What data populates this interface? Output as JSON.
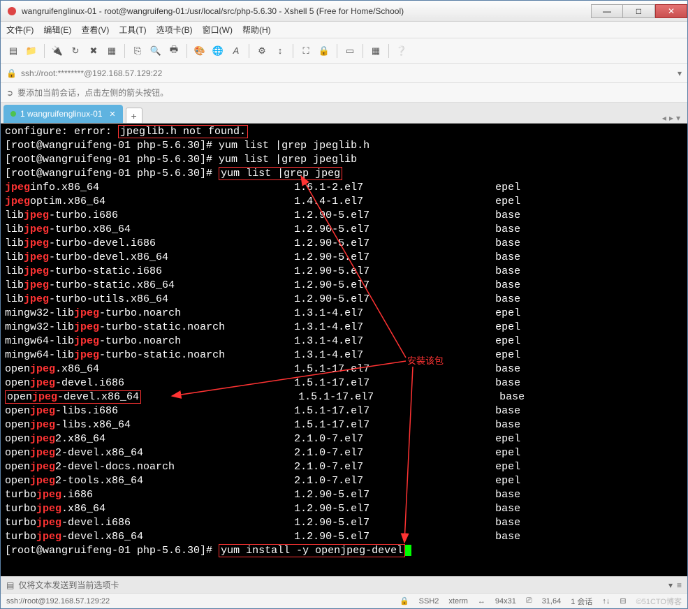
{
  "window": {
    "title": "wangruifenglinux-01 - root@wangruifeng-01:/usr/local/src/php-5.6.30 - Xshell 5 (Free for Home/School)"
  },
  "menu": {
    "file": "文件(F)",
    "edit": "编辑(E)",
    "view": "查看(V)",
    "tools": "工具(T)",
    "opt": "选项卡(B)",
    "window": "窗口(W)",
    "help": "帮助(H)"
  },
  "address": {
    "text": "ssh://root:********@192.168.57.129:22"
  },
  "infobar": {
    "text": "要添加当前会话，点击左侧的箭头按钮。"
  },
  "tab": {
    "label": "1 wangruifenglinux-01",
    "newtab": "+"
  },
  "annotation": {
    "text": "安装该包"
  },
  "terminal": {
    "line_err_p": "configure: error: ",
    "line_err_box": "jpeglib.h not found.",
    "prompt": "[root@wangruifeng-01 php-5.6.30]# ",
    "cmd1": "yum list |grep jpeglib.h",
    "cmd2": "yum list |grep jpeglib",
    "cmd3box": "yum list |grep jpeg",
    "cmd4box": "yum install -y openjpeg-devel",
    "rows": [
      {
        "p": "jpeg",
        "r": "info.x86_64",
        "v": "1.6.1-2.el7",
        "repo": "epel"
      },
      {
        "p": "jpeg",
        "r": "optim.x86_64",
        "v": "1.4.4-1.el7",
        "repo": "epel"
      },
      {
        "p": "lib",
        "m": "jpeg",
        "r": "-turbo.i686",
        "v": "1.2.90-5.el7",
        "repo": "base"
      },
      {
        "p": "lib",
        "m": "jpeg",
        "r": "-turbo.x86_64",
        "v": "1.2.90-5.el7",
        "repo": "base"
      },
      {
        "p": "lib",
        "m": "jpeg",
        "r": "-turbo-devel.i686",
        "v": "1.2.90-5.el7",
        "repo": "base"
      },
      {
        "p": "lib",
        "m": "jpeg",
        "r": "-turbo-devel.x86_64",
        "v": "1.2.90-5.el7",
        "repo": "base"
      },
      {
        "p": "lib",
        "m": "jpeg",
        "r": "-turbo-static.i686",
        "v": "1.2.90-5.el7",
        "repo": "base"
      },
      {
        "p": "lib",
        "m": "jpeg",
        "r": "-turbo-static.x86_64",
        "v": "1.2.90-5.el7",
        "repo": "base"
      },
      {
        "p": "lib",
        "m": "jpeg",
        "r": "-turbo-utils.x86_64",
        "v": "1.2.90-5.el7",
        "repo": "base"
      },
      {
        "p": "mingw32-lib",
        "m": "jpeg",
        "r": "-turbo.noarch",
        "v": "1.3.1-4.el7",
        "repo": "epel"
      },
      {
        "p": "mingw32-lib",
        "m": "jpeg",
        "r": "-turbo-static.noarch",
        "v": "1.3.1-4.el7",
        "repo": "epel"
      },
      {
        "p": "mingw64-lib",
        "m": "jpeg",
        "r": "-turbo.noarch",
        "v": "1.3.1-4.el7",
        "repo": "epel"
      },
      {
        "p": "mingw64-lib",
        "m": "jpeg",
        "r": "-turbo-static.noarch",
        "v": "1.3.1-4.el7",
        "repo": "epel"
      },
      {
        "p": "open",
        "m": "jpeg",
        "r": ".x86_64",
        "v": "1.5.1-17.el7",
        "repo": "base"
      },
      {
        "p": "open",
        "m": "jpeg",
        "r": "-devel.i686",
        "v": "1.5.1-17.el7",
        "repo": "base"
      },
      {
        "p": "open",
        "m": "jpeg",
        "r": "-devel.x86_64",
        "v": "1.5.1-17.el7",
        "repo": "base",
        "boxed": true
      },
      {
        "p": "open",
        "m": "jpeg",
        "r": "-libs.i686",
        "v": "1.5.1-17.el7",
        "repo": "base"
      },
      {
        "p": "open",
        "m": "jpeg",
        "r": "-libs.x86_64",
        "v": "1.5.1-17.el7",
        "repo": "base"
      },
      {
        "p": "open",
        "m": "jpeg",
        "r": "2.x86_64",
        "v": "2.1.0-7.el7",
        "repo": "epel"
      },
      {
        "p": "open",
        "m": "jpeg",
        "r": "2-devel.x86_64",
        "v": "2.1.0-7.el7",
        "repo": "epel"
      },
      {
        "p": "open",
        "m": "jpeg",
        "r": "2-devel-docs.noarch",
        "v": "2.1.0-7.el7",
        "repo": "epel"
      },
      {
        "p": "open",
        "m": "jpeg",
        "r": "2-tools.x86_64",
        "v": "2.1.0-7.el7",
        "repo": "epel"
      },
      {
        "p": "turbo",
        "m": "jpeg",
        "r": ".i686",
        "v": "1.2.90-5.el7",
        "repo": "base"
      },
      {
        "p": "turbo",
        "m": "jpeg",
        "r": ".x86_64",
        "v": "1.2.90-5.el7",
        "repo": "base"
      },
      {
        "p": "turbo",
        "m": "jpeg",
        "r": "-devel.i686",
        "v": "1.2.90-5.el7",
        "repo": "base"
      },
      {
        "p": "turbo",
        "m": "jpeg",
        "r": "-devel.x86_64",
        "v": "1.2.90-5.el7",
        "repo": "base"
      }
    ]
  },
  "status1": {
    "text": "仅将文本发送到当前选项卡"
  },
  "status2": {
    "left": "ssh://root@192.168.57.129:22",
    "ssh": "SSH2",
    "term": "xterm",
    "size": "94x31",
    "pos": "31,64",
    "sess": "1 会话",
    "watermark": "©51CTO博客"
  }
}
